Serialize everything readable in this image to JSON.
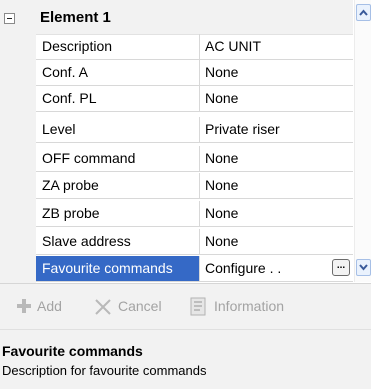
{
  "group": {
    "title": "Element 1",
    "expanded": true
  },
  "properties": [
    {
      "name": "Description",
      "value": "AC UNIT"
    },
    {
      "name": "Conf. A",
      "value": "None"
    },
    {
      "name": "Conf. PL",
      "value": "None"
    },
    {
      "name": "Level",
      "value": "Private riser"
    },
    {
      "name": "OFF command",
      "value": "None"
    },
    {
      "name": "ZA probe",
      "value": "None"
    },
    {
      "name": "ZB probe",
      "value": "None"
    },
    {
      "name": "Slave address",
      "value": "None"
    },
    {
      "name": "Favourite commands",
      "value": "Configure . .",
      "selected": true,
      "button": "..."
    }
  ],
  "toolbar": {
    "add_label": "Add",
    "cancel_label": "Cancel",
    "information_label": "Information",
    "enabled": false
  },
  "description": {
    "title": "Favourite commands",
    "text": "Description for favourite commands"
  },
  "colors": {
    "selection": "#3569c6",
    "panel": "#f2f2f2",
    "disabled_text": "#a3a3a3"
  }
}
